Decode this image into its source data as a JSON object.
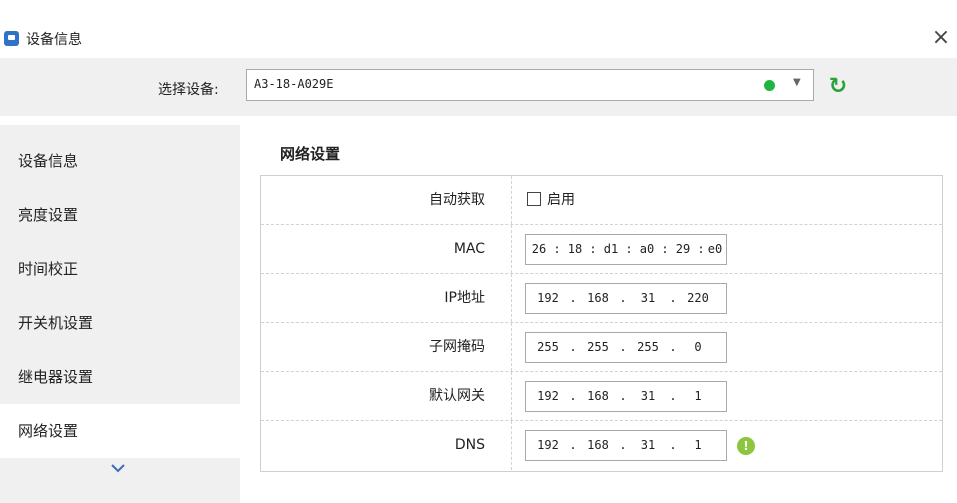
{
  "window": {
    "title": "设备信息",
    "close_glyph": "×"
  },
  "device_bar": {
    "label": "选择设备:",
    "selected": "A3-18-A029E",
    "status_color": "#1fb543",
    "dropdown_glyph": "▼",
    "refresh_glyph": "↻"
  },
  "sidebar": {
    "items": [
      {
        "label": "设备信息",
        "active": false
      },
      {
        "label": "亮度设置",
        "active": false
      },
      {
        "label": "时间校正",
        "active": false
      },
      {
        "label": "开关机设置",
        "active": false
      },
      {
        "label": "继电器设置",
        "active": false
      },
      {
        "label": "网络设置",
        "active": true
      }
    ]
  },
  "network": {
    "title": "网络设置",
    "auto": {
      "label": "自动获取",
      "checkbox_label": "启用",
      "checked": false
    },
    "mac": {
      "label": "MAC",
      "segments": [
        "26",
        "18",
        "d1",
        "a0",
        "29",
        "e0"
      ],
      "separator": ":"
    },
    "ip": {
      "label": "IP地址",
      "segments": [
        "192",
        "168",
        "31",
        "220"
      ],
      "separator": "."
    },
    "mask": {
      "label": "子网掩码",
      "segments": [
        "255",
        "255",
        "255",
        "0"
      ],
      "separator": "."
    },
    "gateway": {
      "label": "默认网关",
      "segments": [
        "192",
        "168",
        "31",
        "1"
      ],
      "separator": "."
    },
    "dns": {
      "label": "DNS",
      "segments": [
        "192",
        "168",
        "31",
        "1"
      ],
      "separator": "."
    },
    "info_glyph": "!"
  },
  "colors": {
    "accent_green": "#2aa23a",
    "info_green": "#8cc63f",
    "app_blue": "#2f73c9"
  }
}
